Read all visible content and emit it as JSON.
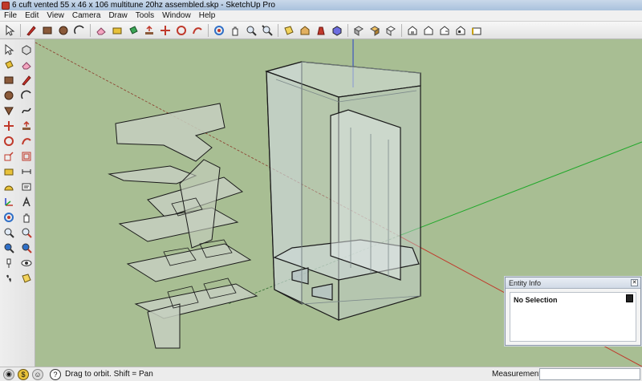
{
  "window": {
    "title": "6 cuft vented 55 x 46 x 106 multitune 20hz assembled.skp - SketchUp Pro"
  },
  "menu": [
    "File",
    "Edit",
    "View",
    "Camera",
    "Draw",
    "Tools",
    "Window",
    "Help"
  ],
  "top_toolbar_icons": [
    "select-icon",
    "pencil-icon",
    "rectangle-icon",
    "circle-icon",
    "arc-icon",
    "eraser-icon",
    "tape-measure-icon",
    "paint-bucket-icon",
    "push-pull-icon",
    "move-icon",
    "rotate-icon",
    "follow-me-icon",
    "orbit-icon",
    "pan-icon",
    "zoom-icon",
    "zoom-extents-icon",
    "section-plane-icon",
    "3d-warehouse-icon",
    "extension-warehouse-icon",
    "components-icon",
    "materials-icon",
    "styles-icon",
    "iso-view-icon",
    "top-view-icon",
    "front-view-icon",
    "right-view-icon",
    "back-view-icon",
    "left-view-icon"
  ],
  "left_toolbar_icons": [
    "select-icon",
    "component-icon",
    "paint-bucket-icon",
    "eraser-icon",
    "rectangle-icon",
    "line-icon",
    "circle-icon",
    "arc-icon",
    "polygon-icon",
    "freehand-icon",
    "move-icon",
    "push-pull-icon",
    "rotate-icon",
    "follow-me-icon",
    "scale-icon",
    "offset-icon",
    "tape-measure-icon",
    "dimension-icon",
    "protractor-icon",
    "text-icon",
    "axes-icon",
    "3d-text-icon",
    "orbit-icon",
    "pan-icon",
    "zoom-icon",
    "zoom-window-icon",
    "zoom-extents-icon",
    "previous-view-icon",
    "position-camera-icon",
    "look-around-icon",
    "walk-icon",
    "section-plane-icon"
  ],
  "entity_info": {
    "title": "Entity Info",
    "selection": "No Selection"
  },
  "status": {
    "text": "Drag to orbit.  Shift = Pan",
    "measurements_label": "Measurements",
    "measurements_value": ""
  },
  "colors": {
    "viewport_bg": "#a8be93",
    "axis_red": "#c0392b",
    "axis_green": "#20a82a",
    "axis_blue": "#2740c8"
  }
}
